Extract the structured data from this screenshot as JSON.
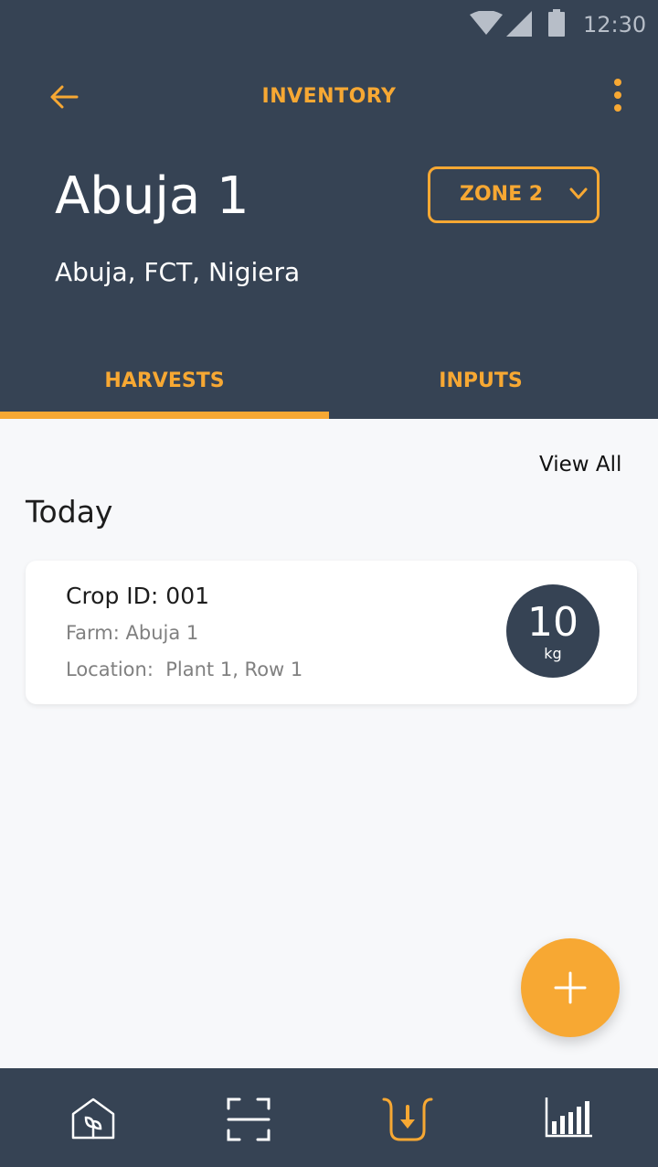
{
  "status_bar": {
    "time": "12:30",
    "icons": [
      "wifi-icon",
      "signal-icon",
      "battery-icon"
    ]
  },
  "app_bar": {
    "title": "INVENTORY",
    "back_icon": "arrow-left-icon",
    "menu_icon": "more-vertical-icon"
  },
  "farm": {
    "name": "Abuja 1",
    "location": "Abuja, FCT, Nigiera"
  },
  "zone_select": {
    "selected": "ZONE 2",
    "icon": "chevron-down-icon"
  },
  "tabs": [
    {
      "label": "HARVESTS",
      "active": true
    },
    {
      "label": "INPUTS",
      "active": false
    }
  ],
  "content": {
    "view_all_label": "View All",
    "section_title": "Today",
    "harvest_card": {
      "crop_id": "Crop ID: 001",
      "farm": "Farm: Abuja 1",
      "location": "Location:  Plant 1, Row 1",
      "quantity": "10",
      "unit": "kg"
    }
  },
  "fab": {
    "icon": "plus-icon"
  },
  "bottom_nav": {
    "items": [
      "greenhouse-icon",
      "scan-icon",
      "harvest-icon",
      "bar-chart-icon"
    ],
    "active_index": 2
  },
  "colors": {
    "primary": "#364354",
    "accent": "#f7a833",
    "background": "#f7f8fa"
  }
}
